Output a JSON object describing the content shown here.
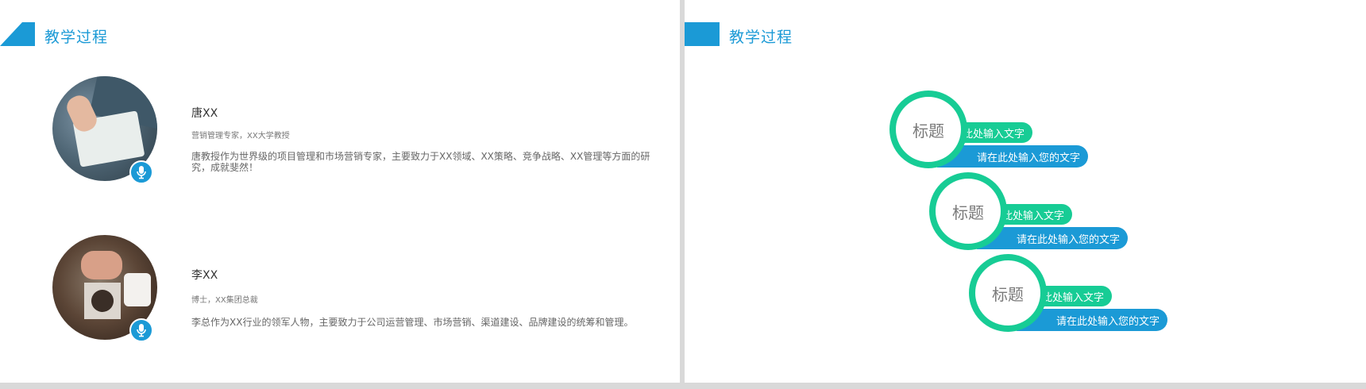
{
  "left_slide": {
    "title": "教学过程",
    "people": [
      {
        "name": "唐XX",
        "role": "营销管理专家，XX大学教授",
        "description": "唐教授作为世界级的项目管理和市场营销专家，主要致力于XX领域、XX策略、竞争战略、XX管理等方面的研究，成就斐然！",
        "photo_icon": "microphone-icon"
      },
      {
        "name": "李XX",
        "role": "博士，XX集团总裁",
        "description": "李总作为XX行业的领军人物，主要致力于公司运营管理、市场营销、渠道建设、品牌建设的统筹和管理。",
        "photo_icon": "microphone-icon"
      }
    ]
  },
  "right_slide": {
    "title": "教学过程",
    "items": [
      {
        "title": "标题",
        "line1": "此处输入文字",
        "line2": "请在此处输入您的文字"
      },
      {
        "title": "标题",
        "line1": "此处输入文字",
        "line2": "请在此处输入您的文字"
      },
      {
        "title": "标题",
        "line1": "此处输入文字",
        "line2": "请在此处输入您的文字"
      }
    ]
  },
  "colors": {
    "accent_blue": "#1b9ad6",
    "accent_green": "#17cc95",
    "divider": "#d9d9d9"
  }
}
